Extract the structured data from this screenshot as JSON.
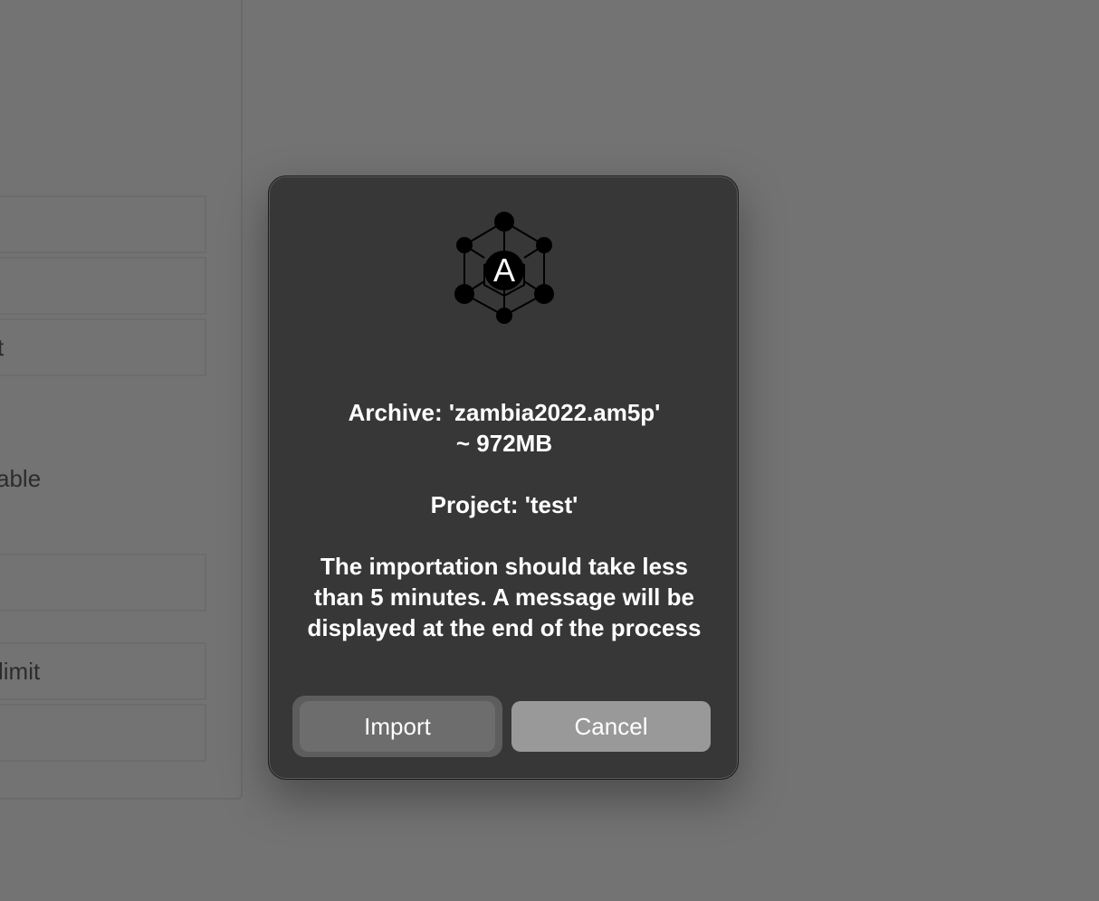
{
  "background": {
    "rows": [
      {
        "label": ""
      },
      {
        "label": ""
      },
      {
        "label": "ct"
      },
      {
        "label": ""
      },
      {
        "label": "limit"
      },
      {
        "label": ""
      }
    ],
    "static_text": "able"
  },
  "dialog": {
    "icon": {
      "name": "app-logo-icon",
      "letter": "A"
    },
    "archive_line": "Archive: 'zambia2022.am5p'",
    "size_line": "~ 972MB",
    "project_line": "Project: 'test'",
    "message": "The importation should take less than 5 minutes. A message will be displayed at the end of the process",
    "import_label": "Import",
    "cancel_label": "Cancel"
  },
  "colors": {
    "backdrop": "#737373",
    "dialog": "#373737",
    "cancel_button": "#999999",
    "import_button": "#6d6d6d"
  }
}
